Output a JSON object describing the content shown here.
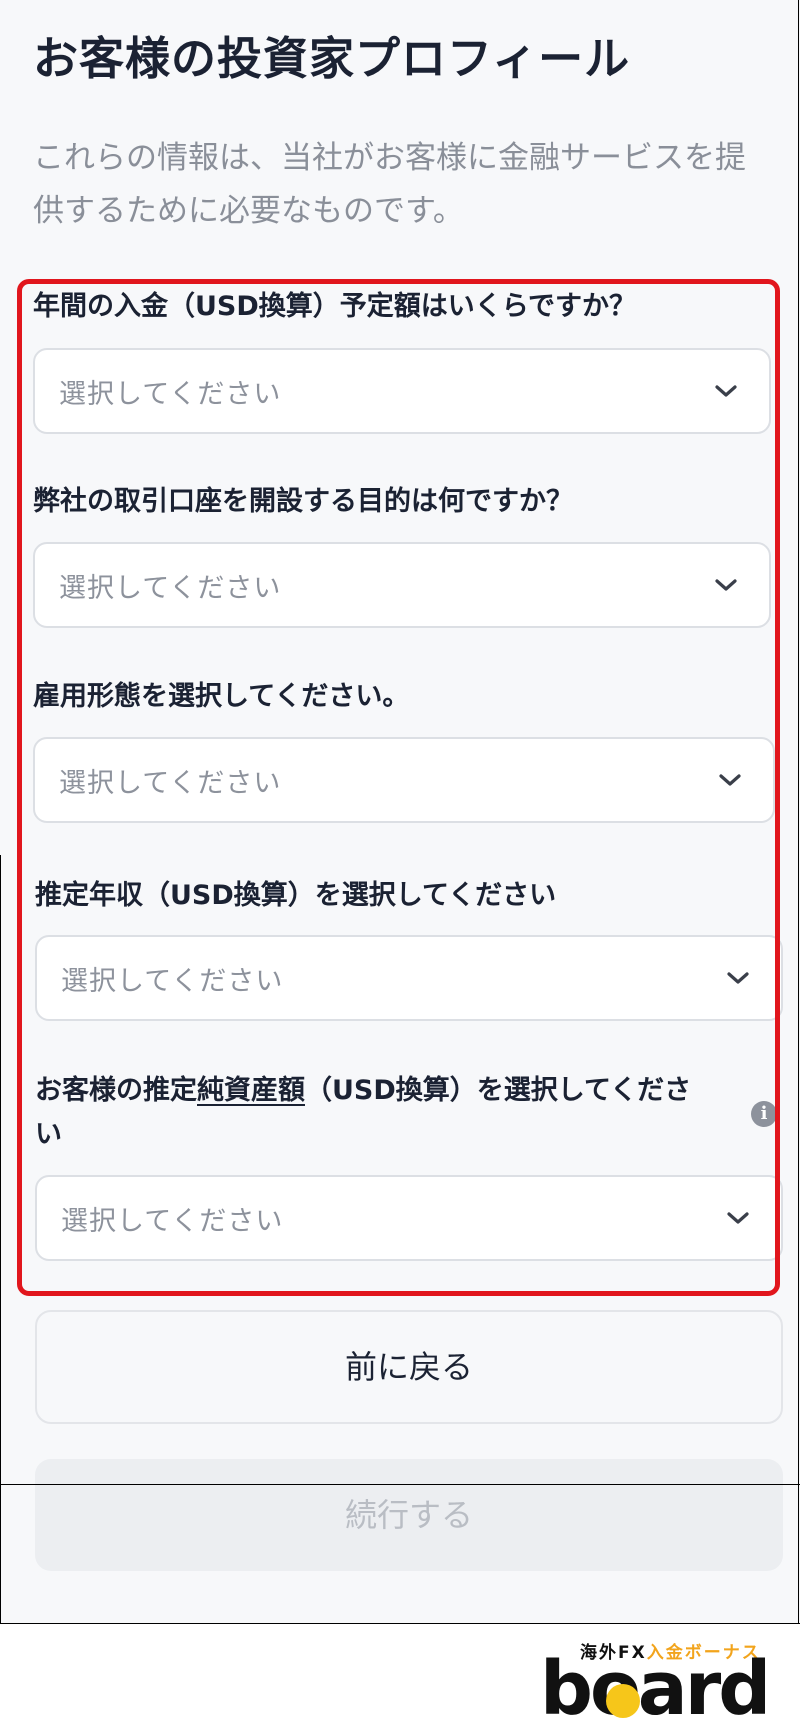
{
  "page": {
    "title": "お客様の投資家プロフィール",
    "description": "これらの情報は、当社がお客様に金融サービスを提供するために必要なものです。"
  },
  "questions": [
    {
      "label": "年間の入金（USD換算）予定額はいくらですか？",
      "placeholder": "選択してください"
    },
    {
      "label": "弊社の取引口座を開設する目的は何ですか？",
      "placeholder": "選択してください"
    },
    {
      "label": "雇用形態を選択してください。",
      "placeholder": "選択してください"
    },
    {
      "label": "推定年収（USD換算）を選択してください",
      "placeholder": "選択してください"
    },
    {
      "label_prefix": "お客様の推定",
      "label_link": "純資産額",
      "label_suffix": "（USD換算）を選択してくださ",
      "label_wrap": "い",
      "placeholder": "選択してください",
      "info_icon": "i"
    }
  ],
  "buttons": {
    "back": "前に戻る",
    "continue": "続行する"
  },
  "watermark": {
    "tagline_black": "海外FX",
    "tagline_orange": "入金ボーナス",
    "wordmark": "board"
  },
  "colors": {
    "highlight": "#e1161d",
    "brand_orange": "#f2a41c"
  }
}
